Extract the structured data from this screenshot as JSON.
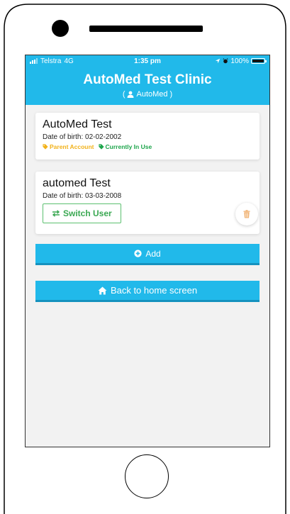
{
  "status_bar": {
    "carrier": "Telstra",
    "network": "4G",
    "time": "1:35 pm",
    "battery": "100%",
    "battery_level": 1.0
  },
  "header": {
    "title": "AutoMed Test Clinic",
    "subtitle": "AutoMed",
    "subtitle_open": "(",
    "subtitle_close": ")",
    "color": "#21b9ea"
  },
  "users": [
    {
      "name": "AutoMed Test",
      "dob_label": "Date of birth: 02-02-2002",
      "tags": {
        "parent": "Parent Account",
        "in_use": "Currently In Use"
      }
    },
    {
      "name": "automed Test",
      "dob_label": "Date of birth: 03-03-2008",
      "switch_label": "Switch User"
    }
  ],
  "buttons": {
    "add_label": "Add",
    "home_label": "Back to home screen"
  },
  "colors": {
    "accent": "#21b9ea",
    "parent_tag": "#f2b21a",
    "in_use_tag": "#1da54b",
    "switch_button": "#3aa852",
    "trash": "#f0b070"
  },
  "icons": [
    "signal-icon",
    "location-arrow-icon",
    "alarm-icon",
    "battery-icon",
    "user-icon",
    "tag-icon",
    "exchange-icon",
    "trash-icon",
    "plus-circle-icon",
    "home-icon"
  ]
}
